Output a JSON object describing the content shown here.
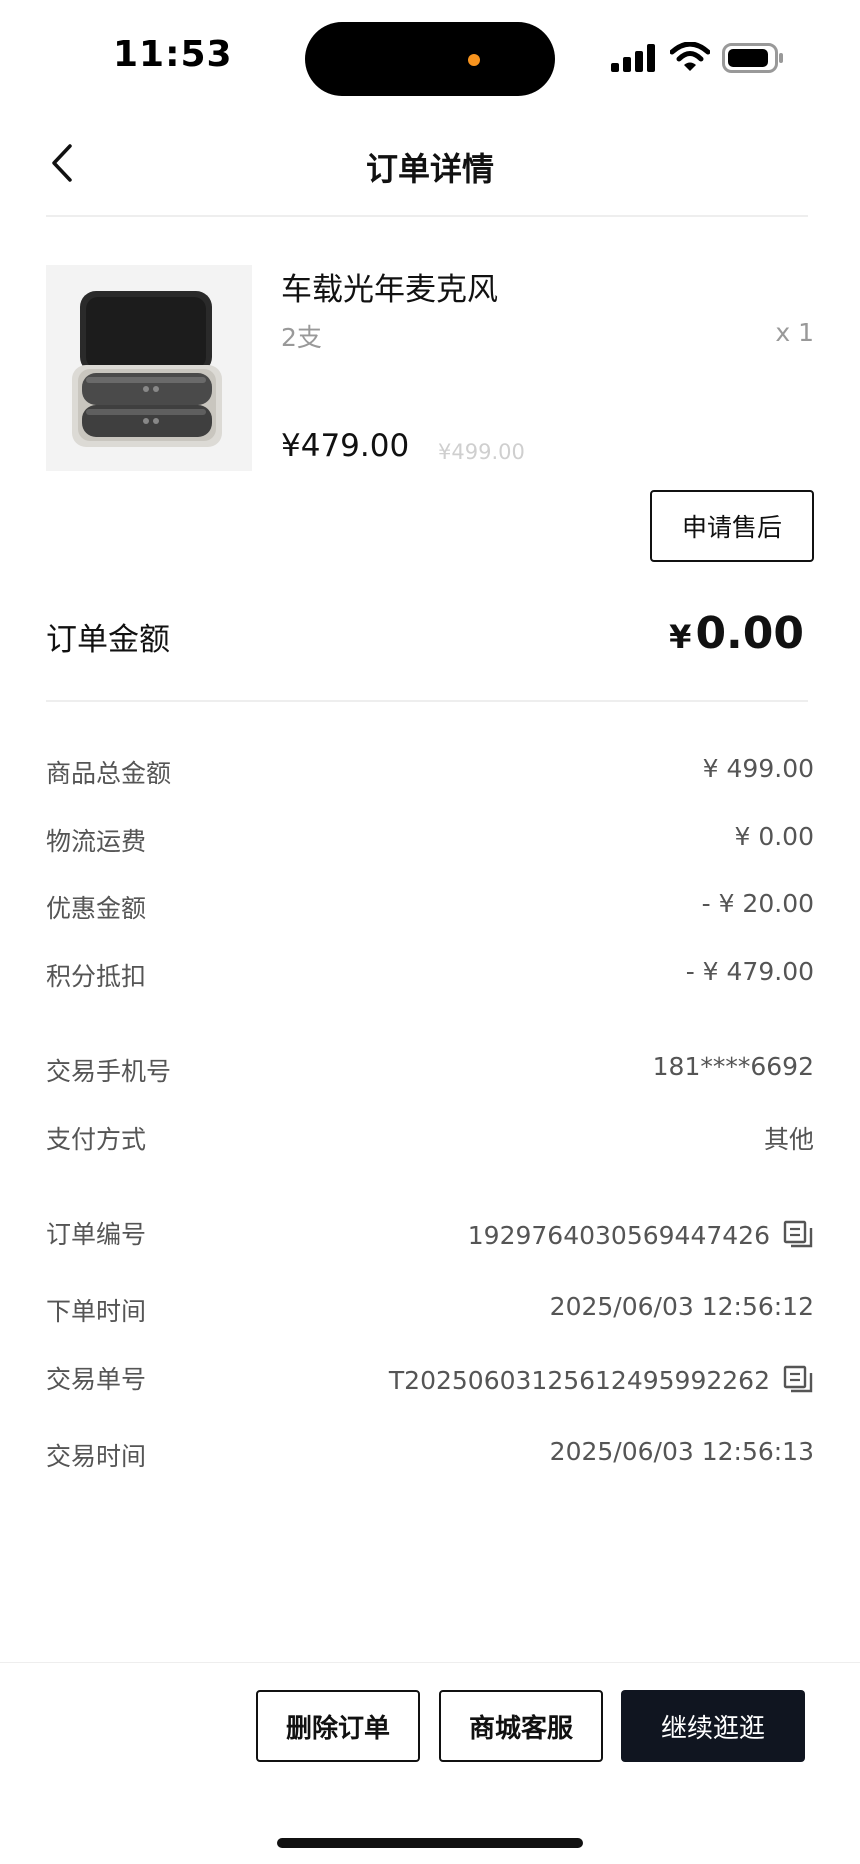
{
  "status_bar": {
    "time": "11:53"
  },
  "nav": {
    "title": "订单详情"
  },
  "product": {
    "name": "车载光年麦克风",
    "spec": "2支",
    "quantity": "x 1",
    "price": "¥479.00",
    "original_price": "¥499.00",
    "after_sale_label": "申请售后"
  },
  "order_amount": {
    "label": "订单金额",
    "currency": "¥",
    "value": "0.00"
  },
  "fees": [
    {
      "label": "商品总金额",
      "value": "¥ 499.00"
    },
    {
      "label": "物流运费",
      "value": "¥ 0.00"
    },
    {
      "label": "优惠金额",
      "value": "- ¥ 20.00"
    },
    {
      "label": "积分抵扣",
      "value": "- ¥ 479.00"
    }
  ],
  "payment": [
    {
      "label": "交易手机号",
      "value": "181****6692"
    },
    {
      "label": "支付方式",
      "value": "其他"
    }
  ],
  "order_info": [
    {
      "label": "订单编号",
      "value": "1929764030569447426"
    },
    {
      "label": "下单时间",
      "value": "2025/06/03 12:56:12"
    },
    {
      "label": "交易单号",
      "value": "T20250603125612495992262"
    },
    {
      "label": "交易时间",
      "value": "2025/06/03 12:56:13"
    }
  ],
  "actions": {
    "delete_order": "删除订单",
    "customer_service": "商城客服",
    "continue_shopping": "继续逛逛"
  },
  "icons": {
    "back": "chevron-left-icon",
    "copy": "copy-icon",
    "signal": "cellular-signal-icon",
    "wifi": "wifi-icon",
    "battery": "battery-icon"
  },
  "colors": {
    "primary_dark": "#101520",
    "text_primary": "#111111",
    "text_secondary": "#555555",
    "text_muted": "#999999",
    "island_dot": "#f7931e"
  }
}
